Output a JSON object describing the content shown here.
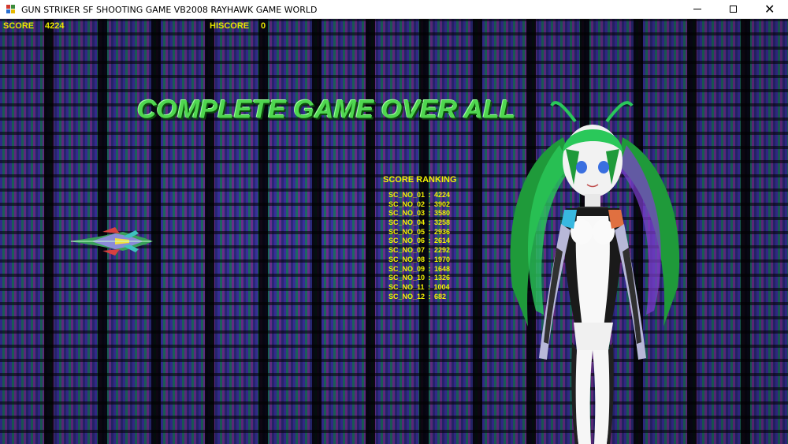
{
  "window": {
    "title": "GUN STRIKER SF SHOOTING GAME VB2008 RAYHAWK GAME WORLD",
    "minimize_glyph": "—",
    "maximize_glyph": "☐",
    "close_glyph": "✕"
  },
  "hud": {
    "score_label": "SCORE",
    "score_value": "4224",
    "hiscore_label": "HISCORE",
    "hiscore_value": "0"
  },
  "banner": "COMPLETE GAME OVER ALL",
  "ranking": {
    "title": "SCORE RANKING",
    "entries": [
      {
        "label": "SC_NO_01",
        "score": "4224"
      },
      {
        "label": "SC_NO_02",
        "score": "3902"
      },
      {
        "label": "SC_NO_03",
        "score": "3580"
      },
      {
        "label": "SC_NO_04",
        "score": "3258"
      },
      {
        "label": "SC_NO_05",
        "score": "2936"
      },
      {
        "label": "SC_NO_06",
        "score": "2614"
      },
      {
        "label": "SC_NO_07",
        "score": "2292"
      },
      {
        "label": "SC_NO_08",
        "score": "1970"
      },
      {
        "label": "SC_NO_09",
        "score": "1648"
      },
      {
        "label": "SC_NO_10",
        "score": "1326"
      },
      {
        "label": "SC_NO_11",
        "score": "1004"
      },
      {
        "label": "SC_NO_12",
        "score": "682"
      }
    ]
  },
  "colors": {
    "hud_text": "#e8e800",
    "banner_green": "#4fd64f",
    "background": "#0a0720"
  },
  "icons": {
    "app": "app-icon",
    "player_ship": "player-ship-icon",
    "character": "character-portrait"
  }
}
